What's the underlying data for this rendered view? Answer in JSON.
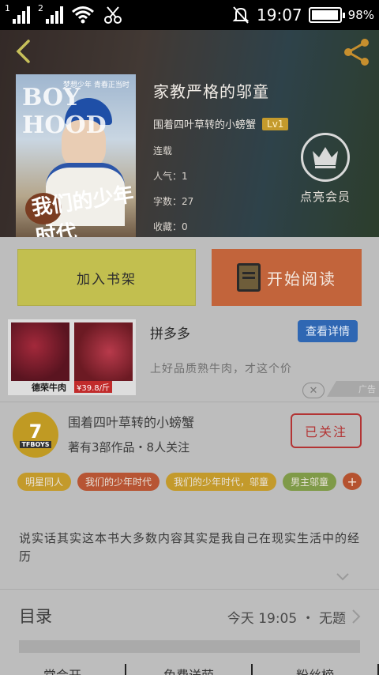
{
  "status_bar": {
    "sim1": "1",
    "sim2": "2",
    "time": "19:07",
    "battery": "98%",
    "battery_level": 0.98
  },
  "book": {
    "title": "家教严格的邬童",
    "author": "围着四叶草转的小螃蟹",
    "level": "Lv1",
    "status": "连载",
    "popularity": "人气：1",
    "word_count": "字数：27",
    "favorites": "收藏：0",
    "cover_text_top": "BOY HOOD",
    "cover_text_bottom": "我们的少年时代",
    "cover_small_text": "梦想少年  青春正当时"
  },
  "vip": {
    "label": "点亮会员"
  },
  "actions": {
    "add_shelf": "加入书架",
    "start_read": "开始阅读"
  },
  "ad": {
    "title": "拼多多",
    "detail_button": "查看详情",
    "description": "上好品质熟牛肉，才这个价",
    "brand": "德荣牛肉",
    "price": "¥39.8/斤",
    "badge": "广告",
    "close": "✕"
  },
  "author_card": {
    "name": "围着四叶草转的小螃蟹",
    "stats": "著有3部作品・8人关注",
    "follow_button": "已关注",
    "avatar_number": "7",
    "avatar_text": "TFBOYS"
  },
  "tags": [
    {
      "label": "明星同人",
      "color": "#c39a2b"
    },
    {
      "label": "我们的少年时代",
      "color": "#b75534"
    },
    {
      "label": "我们的少年时代，邬童",
      "color": "#c39a2b"
    },
    {
      "label": "男主邬童",
      "color": "#7f9a48"
    }
  ],
  "tag_add": "+",
  "description": "说实话其实这本书大多数内容其实是我自己在现实生活中的经历",
  "toc": {
    "label": "目录",
    "latest": "今天 19:05 ・ 无题"
  },
  "bottom_nav": [
    "常会开",
    "免费送萌",
    "粉丝榜"
  ]
}
